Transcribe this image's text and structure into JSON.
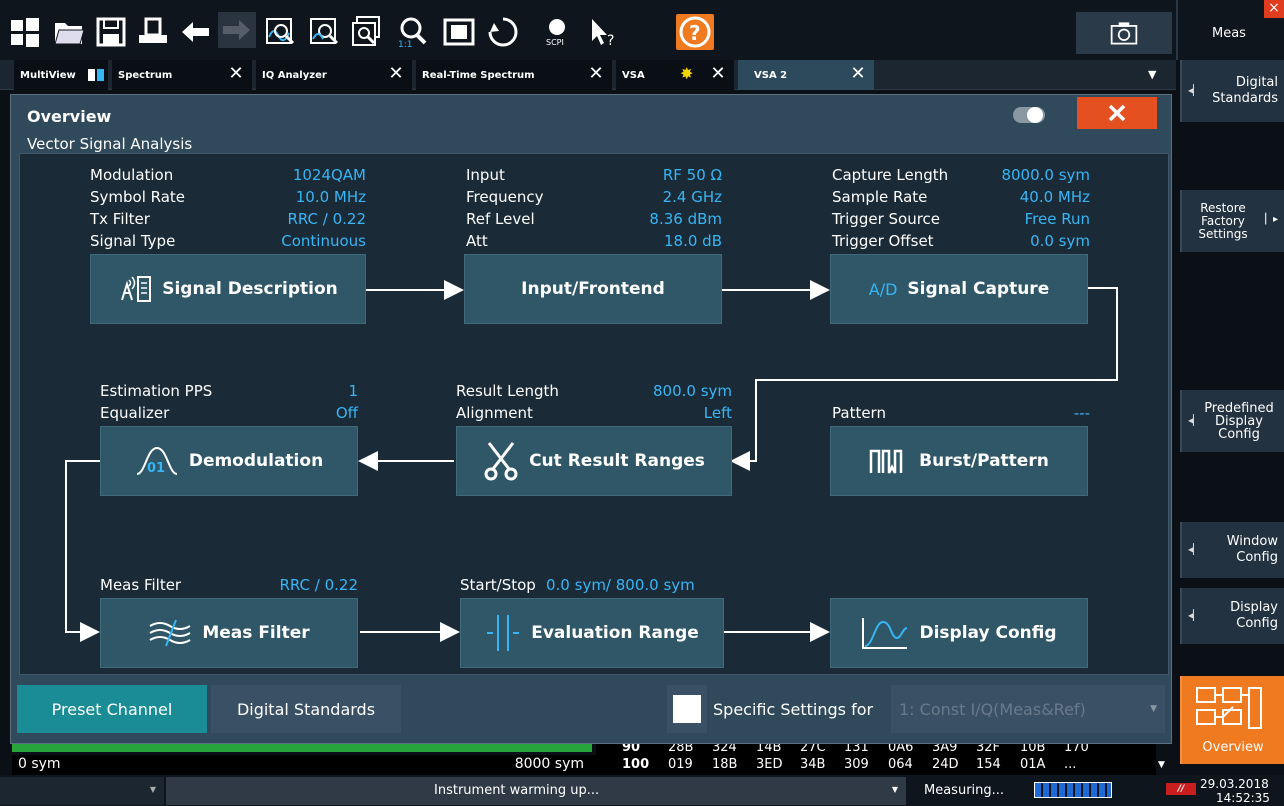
{
  "toolbar": {
    "icons": [
      "windows-icon",
      "folder-open-icon",
      "save-icon",
      "print-icon",
      "undo-icon",
      "redo-icon",
      "zoom-icon",
      "zoom-multi-icon",
      "zoom-window-icon",
      "zoom-1-1-icon",
      "fit-icon",
      "sync-icon",
      "scpi-recorder-icon",
      "help-pointer-icon",
      "help-icon"
    ],
    "scpi_label": "SCPI",
    "zoom_label": "1:1",
    "help_label": "?"
  },
  "side": {
    "meas": "Meas",
    "digital_standards": "Digital\nStandards",
    "restore": "Restore\nFactory\nSettings",
    "predefined": "Predefined\nDisplay\nConfig",
    "window_config": "Window\nConfig",
    "display_config": "Display\nConfig",
    "overview": "Overview"
  },
  "tabs": [
    {
      "label": "MultiView"
    },
    {
      "label": "Spectrum"
    },
    {
      "label": "IQ Analyzer"
    },
    {
      "label": "Real-Time Spectrum"
    },
    {
      "label": "VSA"
    },
    {
      "label": "VSA 2"
    }
  ],
  "dialog": {
    "title": "Overview",
    "section": "Vector Signal Analysis",
    "signal": {
      "rows": [
        [
          "Modulation",
          "1024QAM"
        ],
        [
          "Symbol Rate",
          "10.0 MHz"
        ],
        [
          "Tx Filter",
          "RRC / 0.22"
        ],
        [
          "Signal Type",
          "Continuous"
        ]
      ],
      "block": "Signal Description"
    },
    "input": {
      "rows": [
        [
          "Input",
          "RF 50 Ω"
        ],
        [
          "Frequency",
          "2.4 GHz"
        ],
        [
          "Ref Level",
          "8.36 dBm"
        ],
        [
          "Att",
          "18.0 dB"
        ]
      ],
      "block": "Input/Frontend"
    },
    "capture": {
      "rows": [
        [
          "Capture Length",
          "8000.0 sym"
        ],
        [
          "Sample Rate",
          "40.0 MHz"
        ],
        [
          "Trigger Source",
          "Free Run"
        ],
        [
          "Trigger Offset",
          "0.0 sym"
        ]
      ],
      "block": "Signal Capture",
      "badge": "A/D"
    },
    "demod": {
      "rows": [
        [
          "Estimation PPS",
          "1"
        ],
        [
          "Equalizer",
          "Off"
        ]
      ],
      "block": "Demodulation"
    },
    "cut": {
      "rows": [
        [
          "Result Length",
          "800.0 sym"
        ],
        [
          "Alignment",
          "Left"
        ]
      ],
      "block": "Cut Result Ranges"
    },
    "burst": {
      "rows": [
        [
          "Pattern",
          "---"
        ]
      ],
      "block": "Burst/Pattern"
    },
    "measfilter": {
      "rows": [
        [
          "Meas Filter",
          "RRC / 0.22"
        ]
      ],
      "block": "Meas Filter"
    },
    "evalrange": {
      "key": "Start/Stop",
      "value": "0.0 sym/ 800.0 sym",
      "block": "Evaluation Range"
    },
    "display": {
      "block": "Display Config"
    },
    "preset": "Preset Channel",
    "digital": "Digital Standards",
    "specific_label": "Specific Settings for",
    "specific_value": "1: Const I/Q(Meas&Ref)"
  },
  "bottom": {
    "sym_start": "0 sym",
    "sym_end": "8000 sym",
    "row90": [
      "90",
      "28B",
      "324",
      "14B",
      "27C",
      "131",
      "0A6",
      "3A9",
      "32F",
      "10B",
      "170"
    ],
    "row100": [
      "100",
      "019",
      "18B",
      "3ED",
      "34B",
      "309",
      "064",
      "24D",
      "154",
      "01A",
      "..."
    ]
  },
  "status": {
    "message": "Instrument warming up...",
    "measuring": "Measuring...",
    "date": "29.03.2018",
    "time": "14:52:35"
  },
  "colors": {
    "accent": "#36b6f5",
    "close": "#e55020",
    "overview": "#f07a20",
    "preset": "#1a8c96"
  }
}
